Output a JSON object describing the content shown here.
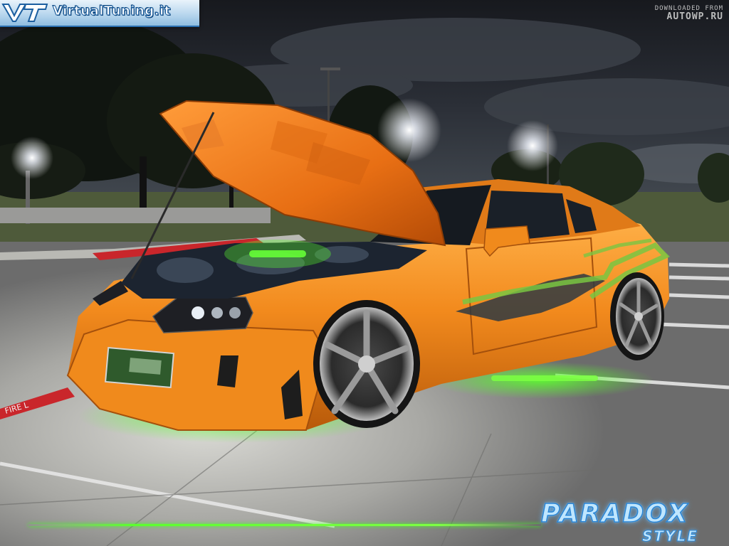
{
  "watermark": {
    "brand_text": "VirtualTuning.it",
    "source_line1": "DOWNLOADED FROM",
    "source_line2": "AUTOWP.RU",
    "artist_name": "PARADOX",
    "artist_sub": "STYLE"
  },
  "scene": {
    "car_color": "#f08a1c",
    "underglow_color": "#4dff2a",
    "sky_color": "#1e2026",
    "pavement_color": "#8f8f8f",
    "curb_marking_color": "#c9262b"
  }
}
